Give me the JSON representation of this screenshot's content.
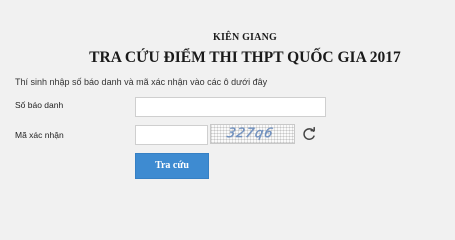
{
  "header": {
    "province": "KIÊN GIANG",
    "title": "TRA CỨU ĐIỂM THI THPT QUỐC GIA 2017"
  },
  "form": {
    "instruction": "Thí sinh nhập số báo danh và mã xác nhận vào các ô dưới đây",
    "candidate_number_label": "Số báo danh",
    "candidate_number_value": "",
    "captcha_label": "Mã xác nhận",
    "captcha_value": "",
    "captcha_text": "327q6",
    "refresh_icon": "refresh-icon",
    "submit_label": "Tra cứu"
  },
  "colors": {
    "background": "#f1f1f1",
    "button": "#3e8bd1",
    "captcha_text": "#6d8fbf"
  }
}
